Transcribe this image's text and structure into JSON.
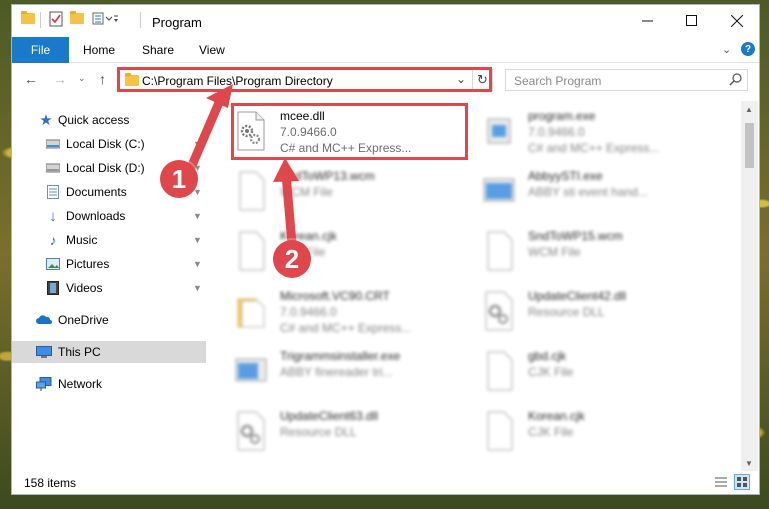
{
  "window": {
    "title": "Program"
  },
  "ribbon": {
    "file_tab": "File",
    "tabs": [
      "Home",
      "Share",
      "View"
    ]
  },
  "navbar": {
    "address_path": "C:\\Program Files\\Program Directory",
    "search_placeholder": "Search Program"
  },
  "sidebar": {
    "items": [
      {
        "label": "Quick access",
        "icon": "star-icon",
        "pinned": false
      },
      {
        "label": "Local Disk (C:)",
        "icon": "drive-icon",
        "pinned": true
      },
      {
        "label": "Local Disk (D:)",
        "icon": "drive-icon",
        "pinned": true
      },
      {
        "label": "Documents",
        "icon": "documents-icon",
        "pinned": true
      },
      {
        "label": "Downloads",
        "icon": "download-arrow-icon",
        "pinned": true
      },
      {
        "label": "Music",
        "icon": "music-note-icon",
        "pinned": true
      },
      {
        "label": "Pictures",
        "icon": "pictures-icon",
        "pinned": true
      },
      {
        "label": "Videos",
        "icon": "film-icon",
        "pinned": true
      },
      {
        "label": "OneDrive",
        "icon": "cloud-icon",
        "pinned": false
      },
      {
        "label": "This PC",
        "icon": "computer-icon",
        "pinned": false,
        "selected": true
      },
      {
        "label": "Network",
        "icon": "network-icon",
        "pinned": false
      }
    ]
  },
  "files": [
    {
      "name": "mcee.dll",
      "line2": "7.0.9466.0",
      "line3": "C# and MC++ Express...",
      "icon": "dll-gear-icon"
    },
    {
      "name": "program.exe",
      "line2": "7.0.9466.0",
      "line3": "C# and MC++ Express...",
      "icon": "exe-icon"
    },
    {
      "name": "SndToWP13.wcm",
      "line2": "WCM File",
      "line3": "",
      "icon": "blank-file-icon"
    },
    {
      "name": "AbbyySTI.exe",
      "line2": "ABBY sti event hand...",
      "line3": "",
      "icon": "exe-window-icon"
    },
    {
      "name": "Korean.cjk",
      "line2": "CJK File",
      "line3": "",
      "icon": "blank-file-icon"
    },
    {
      "name": "SndToWP15.wcm",
      "line2": "WCM File",
      "line3": "",
      "icon": "blank-file-icon"
    },
    {
      "name": "Microsoft.VC90.CRT",
      "line2": "7.0.9466.0",
      "line3": "C# and MC++ Express...",
      "icon": "folder-icon"
    },
    {
      "name": "UpdateClient42.dll",
      "line2": "Resource DLL",
      "line3": "",
      "icon": "dll-gear-icon"
    },
    {
      "name": "Trigrammsinstaller.exe",
      "line2": "ABBY finereader tri...",
      "line3": "",
      "icon": "exe-window-icon"
    },
    {
      "name": "gbd.cjk",
      "line2": "CJK File",
      "line3": "",
      "icon": "blank-file-icon"
    },
    {
      "name": "UpdateClient63.dll",
      "line2": "Resource DLL",
      "line3": "",
      "icon": "dll-gear-icon"
    },
    {
      "name": "Korean.cjk",
      "line2": "CJK File",
      "line3": "",
      "icon": "blank-file-icon"
    }
  ],
  "status": {
    "item_count": "158 items"
  },
  "annotations": {
    "badge_1": "1",
    "badge_2": "2",
    "color": "#e0474c"
  }
}
